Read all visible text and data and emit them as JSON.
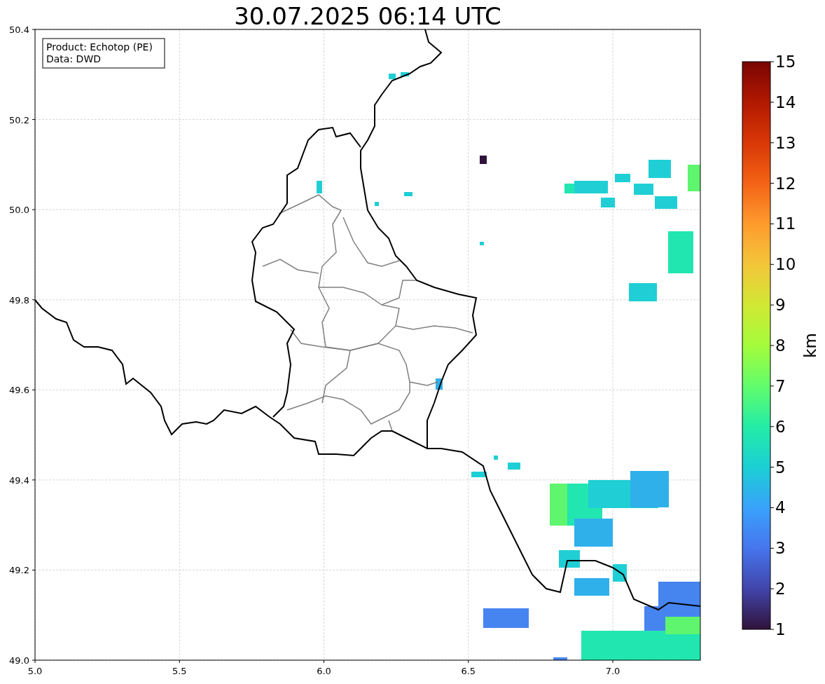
{
  "title": "30.07.2025 06:14 UTC",
  "info_box": [
    "Product: Echotop (PE)",
    "Data: DWD"
  ],
  "x_axis": {
    "ticks": [
      "5.0",
      "5.5",
      "6.0",
      "6.5",
      "7.0"
    ]
  },
  "y_axis": {
    "ticks": [
      "50.4",
      "50.2",
      "50.0",
      "49.8",
      "49.6",
      "49.4",
      "49.2",
      "49.0"
    ]
  },
  "colorbar": {
    "label": "km",
    "ticks": [
      "15",
      "14",
      "13",
      "12",
      "11",
      "10",
      "9",
      "8",
      "7",
      "6",
      "5",
      "4",
      "3",
      "2",
      "1"
    ]
  }
}
